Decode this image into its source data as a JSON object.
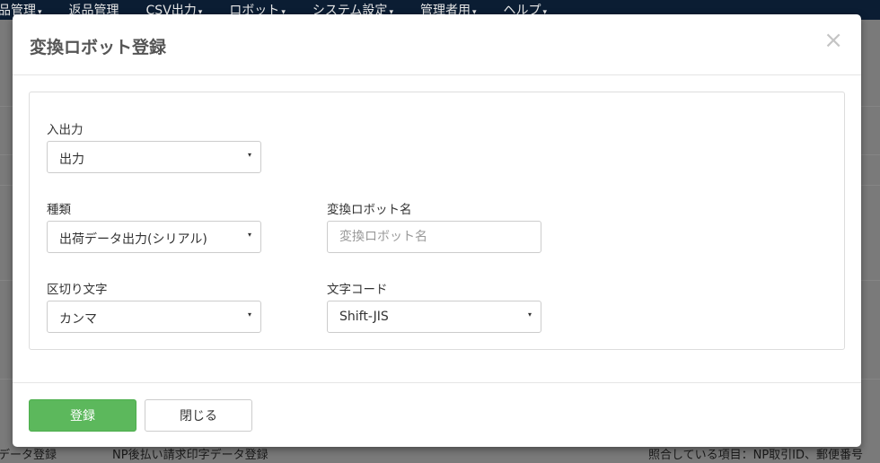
{
  "nav": {
    "items": [
      "品管理",
      "返品管理",
      "CSV出力",
      "ロボット",
      "システム設定",
      "管理者用",
      "ヘルプ"
    ],
    "caret": "▾"
  },
  "background_row": {
    "col1": "データ登録",
    "col2": "NP後払い請求印字データ登録",
    "col3": "照合している項目：NP取引ID、郵便番号"
  },
  "modal": {
    "title": "変換ロボット登録",
    "close_icon": "×",
    "fields": {
      "io": {
        "label": "入出力",
        "value": "出力"
      },
      "type": {
        "label": "種類",
        "value": "出荷データ出力(シリアル)"
      },
      "robot_name": {
        "label": "変換ロボット名",
        "placeholder": "変換ロボット名",
        "value": ""
      },
      "delimiter": {
        "label": "区切り文字",
        "value": "カンマ"
      },
      "charset": {
        "label": "文字コード",
        "value": "Shift-JIS"
      }
    },
    "select_arrow": "▾",
    "buttons": {
      "submit": "登録",
      "close": "閉じる"
    }
  },
  "colors": {
    "primary_button": "#5cb85c",
    "nav_bg": "#0b1d33"
  }
}
